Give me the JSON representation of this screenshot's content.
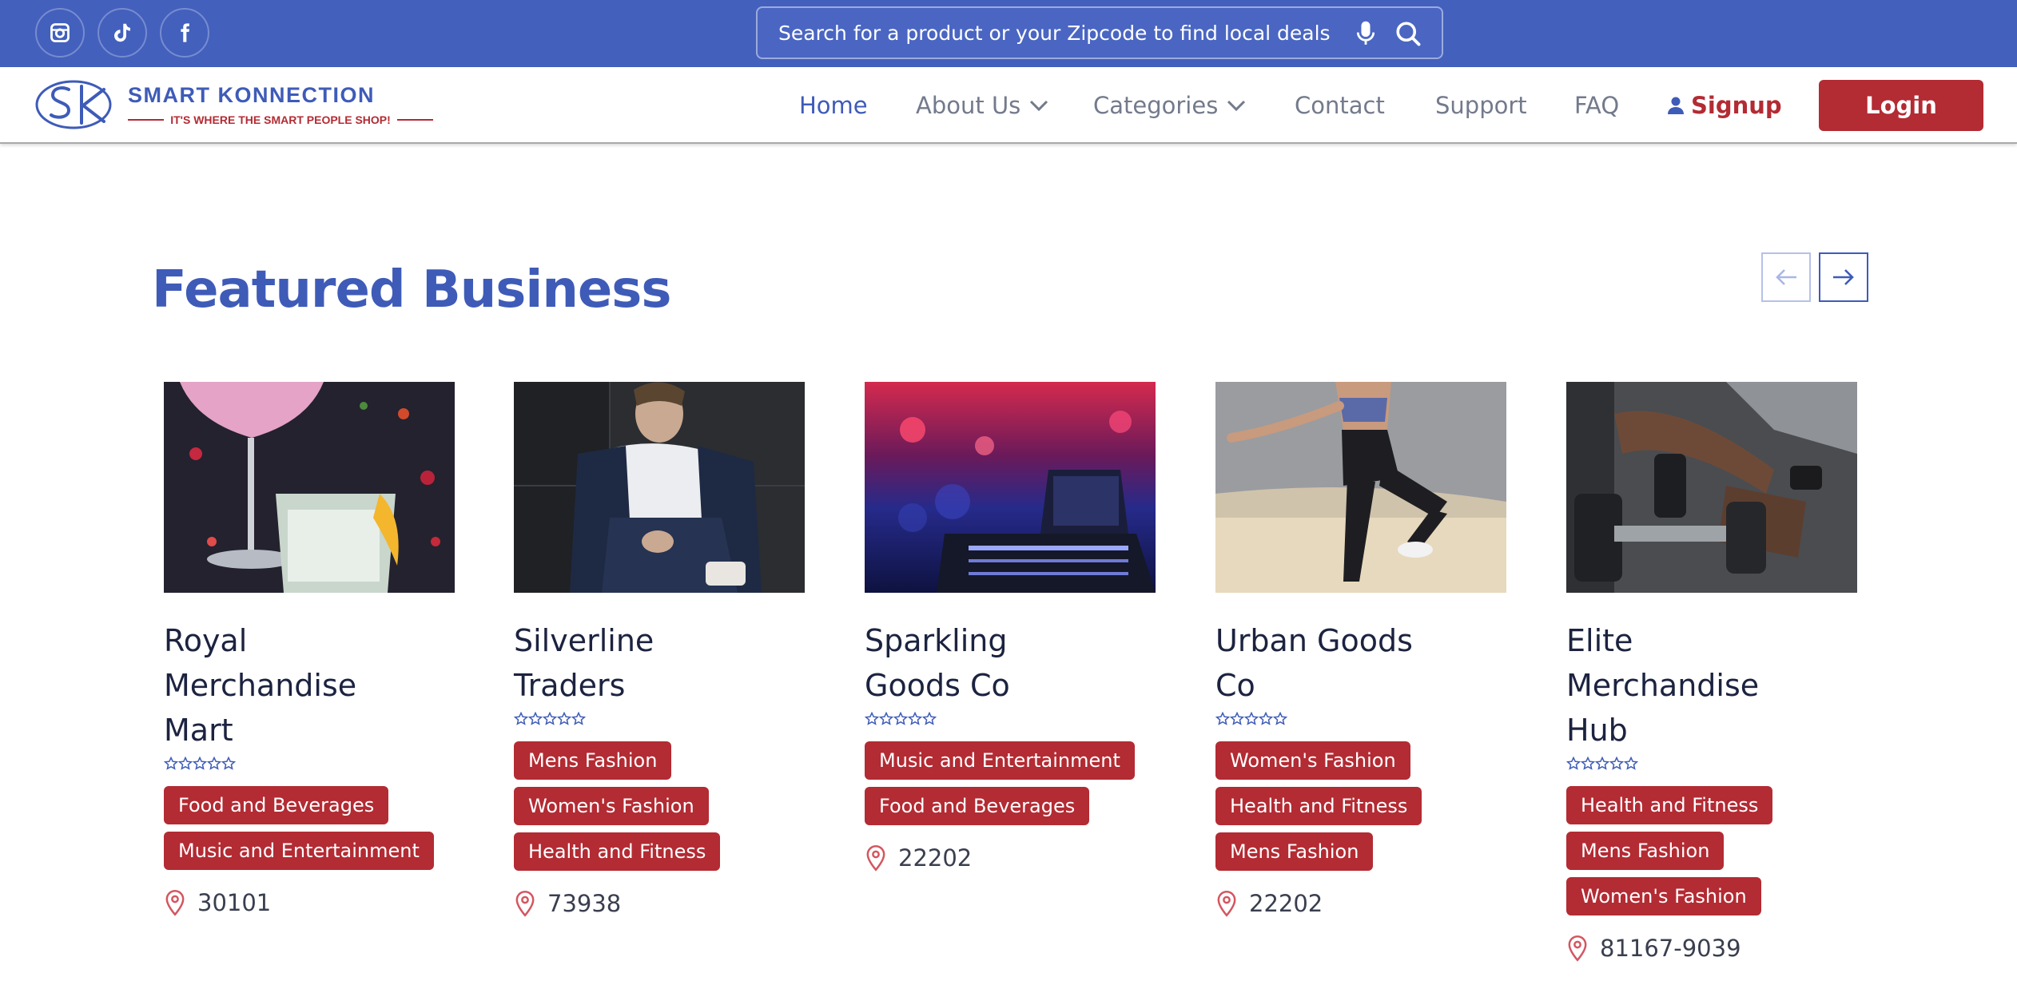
{
  "topbar": {
    "social_icons": [
      "instagram-icon",
      "tiktok-icon",
      "facebook-icon"
    ],
    "search_placeholder": "Search for a product or your Zipcode to find local deals",
    "search_icons": [
      "microphone-icon",
      "search-icon"
    ]
  },
  "brand": {
    "logo_text": "SK",
    "name": "SMART KONNECTION",
    "tagline": "IT'S WHERE THE SMART PEOPLE SHOP!"
  },
  "nav": {
    "home": "Home",
    "about": "About Us",
    "categories": "Categories",
    "contact": "Contact",
    "support": "Support",
    "faq": "FAQ",
    "signup": "Signup",
    "login": "Login"
  },
  "featured": {
    "title": "Featured Business",
    "prev_icon": "arrow-left-icon",
    "next_icon": "arrow-right-icon",
    "cards": [
      {
        "name": "Royal Merchandise Mart",
        "rating": 0,
        "tags": [
          "Food and Beverages",
          "Music and Entertainment"
        ],
        "zip": "30101",
        "image": "cocktail-drinks-photo"
      },
      {
        "name": "Silverline Traders",
        "rating": 0,
        "tags": [
          "Mens Fashion",
          "Women's Fashion",
          "Health and Fitness"
        ],
        "zip": "73938",
        "image": "man-fashion-photo"
      },
      {
        "name": "Sparkling Goods Co",
        "rating": 0,
        "tags": [
          "Music and Entertainment",
          "Food and Beverages"
        ],
        "zip": "22202",
        "image": "concert-stage-photo"
      },
      {
        "name": "Urban Goods Co",
        "rating": 0,
        "tags": [
          "Women's Fashion",
          "Health and Fitness",
          "Mens Fashion"
        ],
        "zip": "22202",
        "image": "woman-fitness-photo"
      },
      {
        "name": "Elite Merchandise Hub",
        "rating": 0,
        "tags": [
          "Health and Fitness",
          "Mens Fashion",
          "Women's Fashion"
        ],
        "zip": "81167-9039",
        "image": "gym-dumbbell-photo"
      }
    ]
  },
  "colors": {
    "brand_blue": "#4360bd",
    "accent_red": "#b32b33",
    "nav_text": "#737a8c"
  }
}
